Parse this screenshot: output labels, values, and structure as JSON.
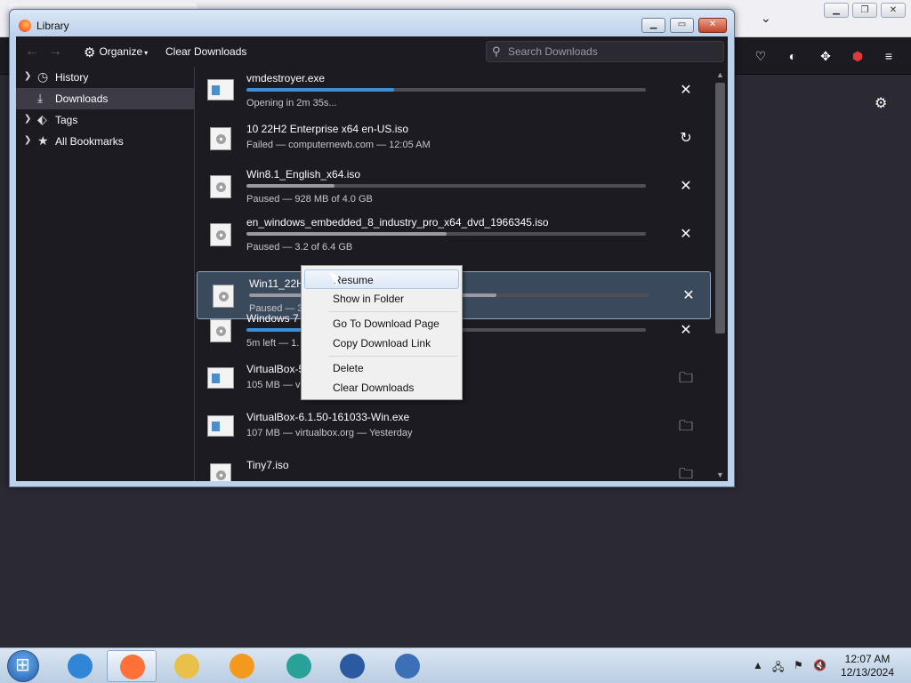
{
  "window": {
    "title": "Library"
  },
  "toolbar": {
    "back_icon": "back-arrow-icon",
    "forward_icon": "forward-arrow-icon",
    "organize_label": "Organize",
    "clear_label": "Clear Downloads",
    "search_placeholder": "Search Downloads"
  },
  "sidebar": {
    "items": [
      {
        "label": "History",
        "icon": "clock-icon",
        "expandable": true
      },
      {
        "label": "Downloads",
        "icon": "download-icon",
        "expandable": false,
        "selected": true
      },
      {
        "label": "Tags",
        "icon": "tag-icon",
        "expandable": true
      },
      {
        "label": "All Bookmarks",
        "icon": "star-icon",
        "expandable": true
      }
    ]
  },
  "downloads": [
    {
      "name": "vmdestroyer.exe",
      "status": "Opening in 2m 35s...",
      "progress": 0.37,
      "bar_color": "#3a8fd8",
      "action": "cancel",
      "type": "exe"
    },
    {
      "name": "10 22H2 Enterprise x64 en-US.iso",
      "status": "Failed — computernewb.com — 12:05 AM",
      "progress": null,
      "action": "retry",
      "type": "iso"
    },
    {
      "name": "Win8.1_English_x64.iso",
      "status": "Paused — 928 MB of 4.0 GB",
      "progress": 0.22,
      "bar_color": "#9a9aa2",
      "action": "cancel",
      "type": "iso"
    },
    {
      "name": "en_windows_embedded_8_industry_pro_x64_dvd_1966345.iso",
      "status": "Paused — 3.2 of 6.4 GB",
      "progress": 0.5,
      "bar_color": "#9a9aa2",
      "action": "cancel",
      "type": "iso"
    },
    {
      "name": "Win11_22H",
      "status": "Paused — 3",
      "progress": 0.62,
      "bar_color": "#9a9aa2",
      "action": "cancel",
      "type": "iso",
      "selected": true
    },
    {
      "name": "Windows 7",
      "status": "5m left — 1.",
      "progress": 0.45,
      "bar_color": "#3a8fd8",
      "action": "cancel",
      "type": "iso"
    },
    {
      "name": "VirtualBox-5",
      "status": "105 MB — v",
      "progress": null,
      "action": "folder",
      "type": "exe"
    },
    {
      "name": "VirtualBox-6.1.50-161033-Win.exe",
      "status": "107 MB — virtualbox.org — Yesterday",
      "progress": null,
      "action": "folder",
      "type": "exe"
    },
    {
      "name": "Tiny7.iso",
      "status": "",
      "progress": null,
      "action": "folder",
      "type": "iso"
    }
  ],
  "context_menu": {
    "items": [
      {
        "label": "Resume",
        "highlighted": true
      },
      {
        "label": "Show in Folder"
      },
      {
        "label": "Go To Download Page"
      },
      {
        "label": "Copy Download Link"
      },
      {
        "label": "Delete"
      },
      {
        "label": "Clear Downloads"
      }
    ]
  },
  "taskbar": {
    "apps": [
      {
        "name": "internet-explorer-icon",
        "color": "#2f86d6"
      },
      {
        "name": "firefox-icon",
        "color": "#ff7139",
        "active": true
      },
      {
        "name": "file-explorer-icon",
        "color": "#e8c04a"
      },
      {
        "name": "media-player-icon",
        "color": "#f39a1e"
      },
      {
        "name": "vm-app-icon",
        "color": "#2aa198"
      },
      {
        "name": "virtualbox-icon",
        "color": "#2c5aa0"
      },
      {
        "name": "windows98-icon",
        "color": "#3b6fb6"
      }
    ],
    "clock_time": "12:07 AM",
    "clock_date": "12/13/2024"
  }
}
